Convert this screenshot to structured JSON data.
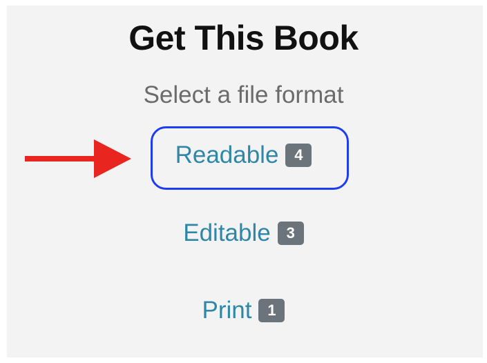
{
  "header": {
    "title": "Get This Book",
    "subtitle": "Select a file format"
  },
  "formats": [
    {
      "label": "Readable",
      "count": "4"
    },
    {
      "label": "Editable",
      "count": "3"
    },
    {
      "label": "Print",
      "count": "1"
    }
  ],
  "colors": {
    "link": "#2f87a8",
    "badge": "#6b737b",
    "highlight_border": "#1f3df0",
    "arrow": "#e8261f",
    "panel_bg": "#f3f3f3"
  },
  "annotations": {
    "highlighted_format": "Readable",
    "pointer_icon": "arrow-right-icon"
  }
}
